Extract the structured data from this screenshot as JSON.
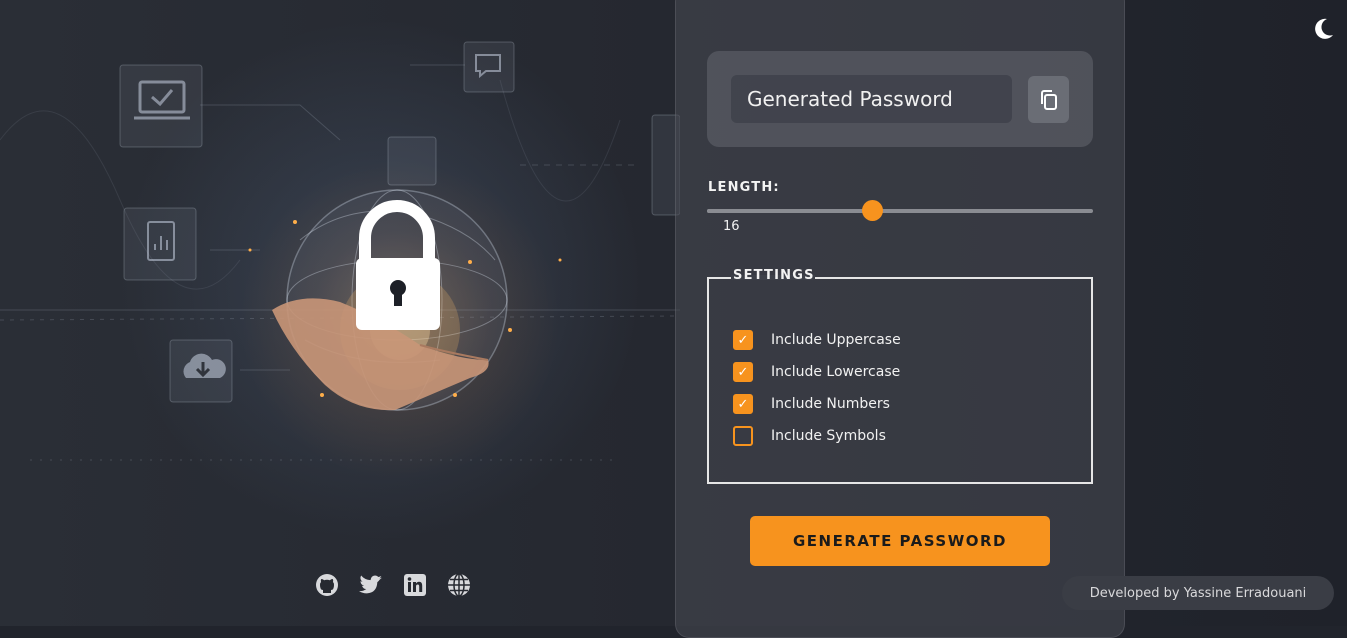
{
  "password": {
    "display": "Generated Password",
    "copy_icon": "copy-icon"
  },
  "length": {
    "label": "LENGTH:",
    "value": "16",
    "min": 4,
    "max": 32,
    "current": 16
  },
  "settings": {
    "legend": "SETTINGS",
    "options": [
      {
        "label": "Include Uppercase",
        "checked": true
      },
      {
        "label": "Include Lowercase",
        "checked": true
      },
      {
        "label": "Include Numbers",
        "checked": true
      },
      {
        "label": "Include Symbols",
        "checked": false
      }
    ]
  },
  "generate_label": "GENERATE PASSWORD",
  "theme_icon": "moon-icon",
  "socials": [
    "github-icon",
    "twitter-icon",
    "linkedin-icon",
    "globe-icon"
  ],
  "credit": "Developed by Yassine Erradouani",
  "colors": {
    "accent": "#f7931e",
    "background": "#21242c",
    "panel": "#484b54"
  }
}
